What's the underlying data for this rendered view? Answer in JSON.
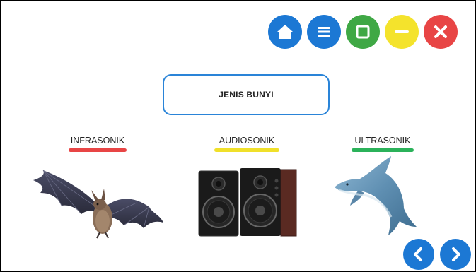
{
  "title": "JENIS BUNYI",
  "categories": [
    {
      "label": "INFRASONIK",
      "color": "#e84545",
      "picture": "bat"
    },
    {
      "label": "AUDIOSONIK",
      "color": "#f0e02a",
      "picture": "speakers"
    },
    {
      "label": "ULTRASONIK",
      "color": "#2bb25a",
      "picture": "dolphin"
    }
  ],
  "toolbar": {
    "home": {
      "icon": "home-icon",
      "color": "#1c78d4"
    },
    "menu": {
      "icon": "menu-icon",
      "color": "#1c78d4"
    },
    "maximize": {
      "icon": "maximize-icon",
      "color": "#3fa845"
    },
    "minimize": {
      "icon": "minimize-icon",
      "color": "#f4e32c"
    },
    "close": {
      "icon": "close-icon",
      "color": "#e84545"
    }
  },
  "navigation": {
    "prev": {
      "icon": "chevron-left-icon",
      "color": "#1c78d4"
    },
    "next": {
      "icon": "chevron-right-icon",
      "color": "#1c78d4"
    }
  }
}
